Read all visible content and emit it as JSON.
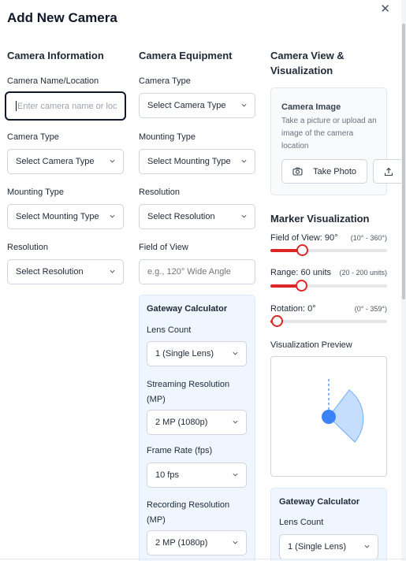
{
  "dialog": {
    "title": "Add New Camera",
    "close_glyph": "✕"
  },
  "camera_information": {
    "heading": "Camera Information",
    "name_label": "Camera Name/Location",
    "name_placeholder": "Enter camera name or loc",
    "type_label": "Camera Type",
    "type_value": "Select Camera Type",
    "mounting_label": "Mounting Type",
    "mounting_value": "Select Mounting Type",
    "resolution_label": "Resolution",
    "resolution_value": "Select Resolution"
  },
  "camera_equipment": {
    "heading": "Camera Equipment",
    "type_label": "Camera Type",
    "type_value": "Select Camera Type",
    "mounting_label": "Mounting Type",
    "mounting_value": "Select Mounting Type",
    "resolution_label": "Resolution",
    "resolution_value": "Select Resolution",
    "fov_label": "Field of View",
    "fov_placeholder": "e.g., 120° Wide Angle",
    "gateway": {
      "title": "Gateway Calculator",
      "lens_label": "Lens Count",
      "lens_value": "1 (Single Lens)",
      "stream_label_line1": "Streaming Resolution",
      "stream_label_line2": "(MP)",
      "stream_value": "2 MP (1080p)",
      "fps_label": "Frame Rate (fps)",
      "fps_value": "10 fps",
      "record_label_line1": "Recording Resolution",
      "record_label_line2": "(MP)",
      "record_value": "2 MP (1080p)"
    }
  },
  "camera_view": {
    "heading_line1": "Camera View &",
    "heading_line2": "Visualization",
    "image_title": "Camera Image",
    "image_desc": "Take a picture or upload an image of the camera location",
    "take_photo_label": "Take Photo",
    "marker_heading": "Marker Visualization",
    "fov": {
      "label": "Field of View: 90°",
      "range": "(10° - 360°)",
      "min": 10,
      "max": 360,
      "value": 90
    },
    "range": {
      "label": "Range: 60 units",
      "range": "(20 - 200 units)",
      "min": 20,
      "max": 200,
      "value": 60
    },
    "rotation": {
      "label": "Rotation: 0°",
      "range": "(0° - 359°)",
      "min": 0,
      "max": 359,
      "value": 0
    },
    "preview_label": "Visualization Preview",
    "gateway": {
      "title": "Gateway Calculator",
      "lens_label": "Lens Count",
      "lens_value": "1 (Single Lens)"
    }
  },
  "colors": {
    "accent": "#dc2626",
    "marker": "#3b82f6",
    "cone_fill": "#bfdbfe"
  }
}
